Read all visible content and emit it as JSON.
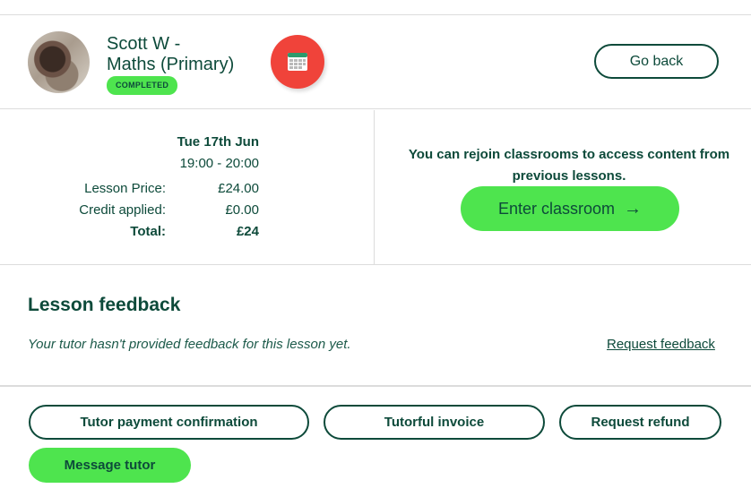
{
  "tutor": {
    "name_line1": "Scott W -",
    "name_line2": "Maths (Primary)",
    "status": "COMPLETED"
  },
  "header": {
    "go_back_label": "Go back",
    "calendar_icon": "calendar-icon",
    "calendar_color": "#f0433a"
  },
  "lesson": {
    "date": "Tue 17th Jun",
    "time": "19:00 - 20:00",
    "price_label": "Lesson Price:",
    "price_value": "£24.00",
    "credit_label": "Credit applied:",
    "credit_value": "£0.00",
    "total_label": "Total:",
    "total_value": "£24"
  },
  "classroom": {
    "message": "You can rejoin classrooms to access content from previous lessons.",
    "enter_label": "Enter classroom",
    "arrow": "→"
  },
  "feedback": {
    "title": "Lesson feedback",
    "message": "Your tutor hasn't provided feedback for this lesson yet.",
    "request_label": "Request feedback"
  },
  "actions": {
    "payment_confirmation": "Tutor payment confirmation",
    "invoice": "Tutorful invoice",
    "refund": "Request refund",
    "message_tutor": "Message tutor"
  },
  "colors": {
    "brand_dark": "#0d4a3a",
    "accent_green": "#4ee44e",
    "border": "#dcdcdc"
  }
}
